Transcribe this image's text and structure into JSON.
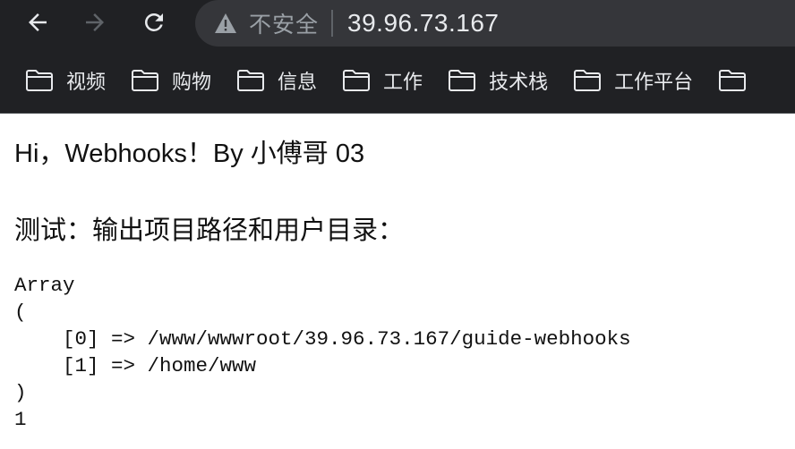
{
  "browser": {
    "back_icon": "arrow-left-icon",
    "forward_icon": "arrow-right-icon",
    "reload_icon": "reload-icon",
    "security_icon": "warning-triangle-icon",
    "security_label": "不安全",
    "url": "39.96.73.167"
  },
  "bookmarks": [
    {
      "label": "视频",
      "icon": "folder-icon"
    },
    {
      "label": "购物",
      "icon": "folder-icon"
    },
    {
      "label": "信息",
      "icon": "folder-icon"
    },
    {
      "label": "工作",
      "icon": "folder-icon"
    },
    {
      "label": "技术栈",
      "icon": "folder-icon"
    },
    {
      "label": "工作平台",
      "icon": "folder-icon"
    },
    {
      "label": "",
      "icon": "folder-icon"
    }
  ],
  "page": {
    "greeting": "Hi，Webhooks！By 小傅哥 03",
    "test_heading": "测试：输出项目路径和用户目录：",
    "output_lines": [
      "Array",
      "(",
      "    [0] => /www/wwwroot/39.96.73.167/guide-webhooks",
      "    [1] => /home/www",
      ")",
      "1"
    ]
  },
  "colors": {
    "toolbar_bg": "#202124",
    "omnibox_bg": "#35363a",
    "toolbar_text": "#e8eaed",
    "muted_text": "#9aa0a6",
    "page_bg": "#ffffff"
  }
}
